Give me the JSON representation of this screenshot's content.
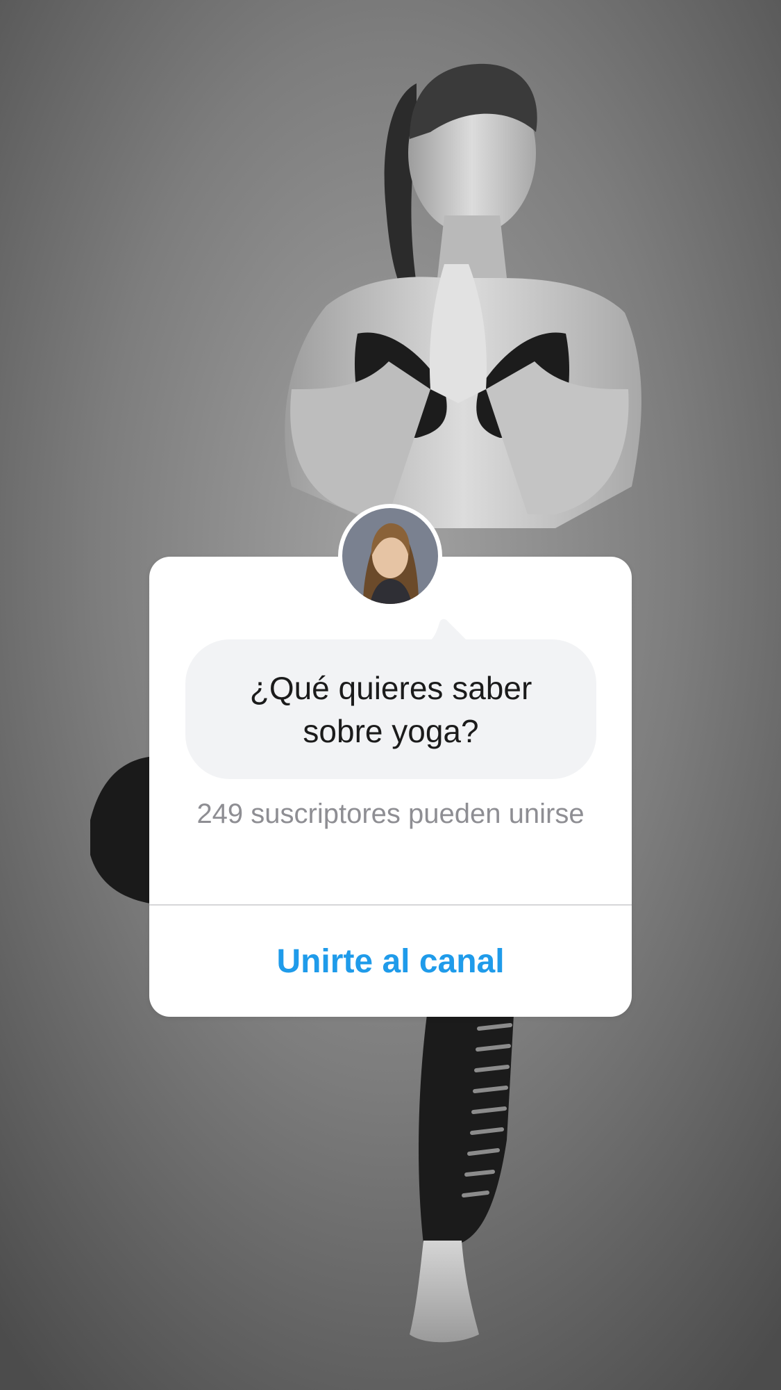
{
  "story": {
    "background_photo": "black-and-white photo of a woman in a yoga tree pose with hands in prayer position"
  },
  "sticker": {
    "avatar_icon": "profile-photo",
    "question": "¿Qué quieres saber sobre yoga?",
    "subscribers_text": "249 suscriptores pueden unirse",
    "join_label": "Unirte al canal",
    "accent_color": "#1f9bea"
  }
}
